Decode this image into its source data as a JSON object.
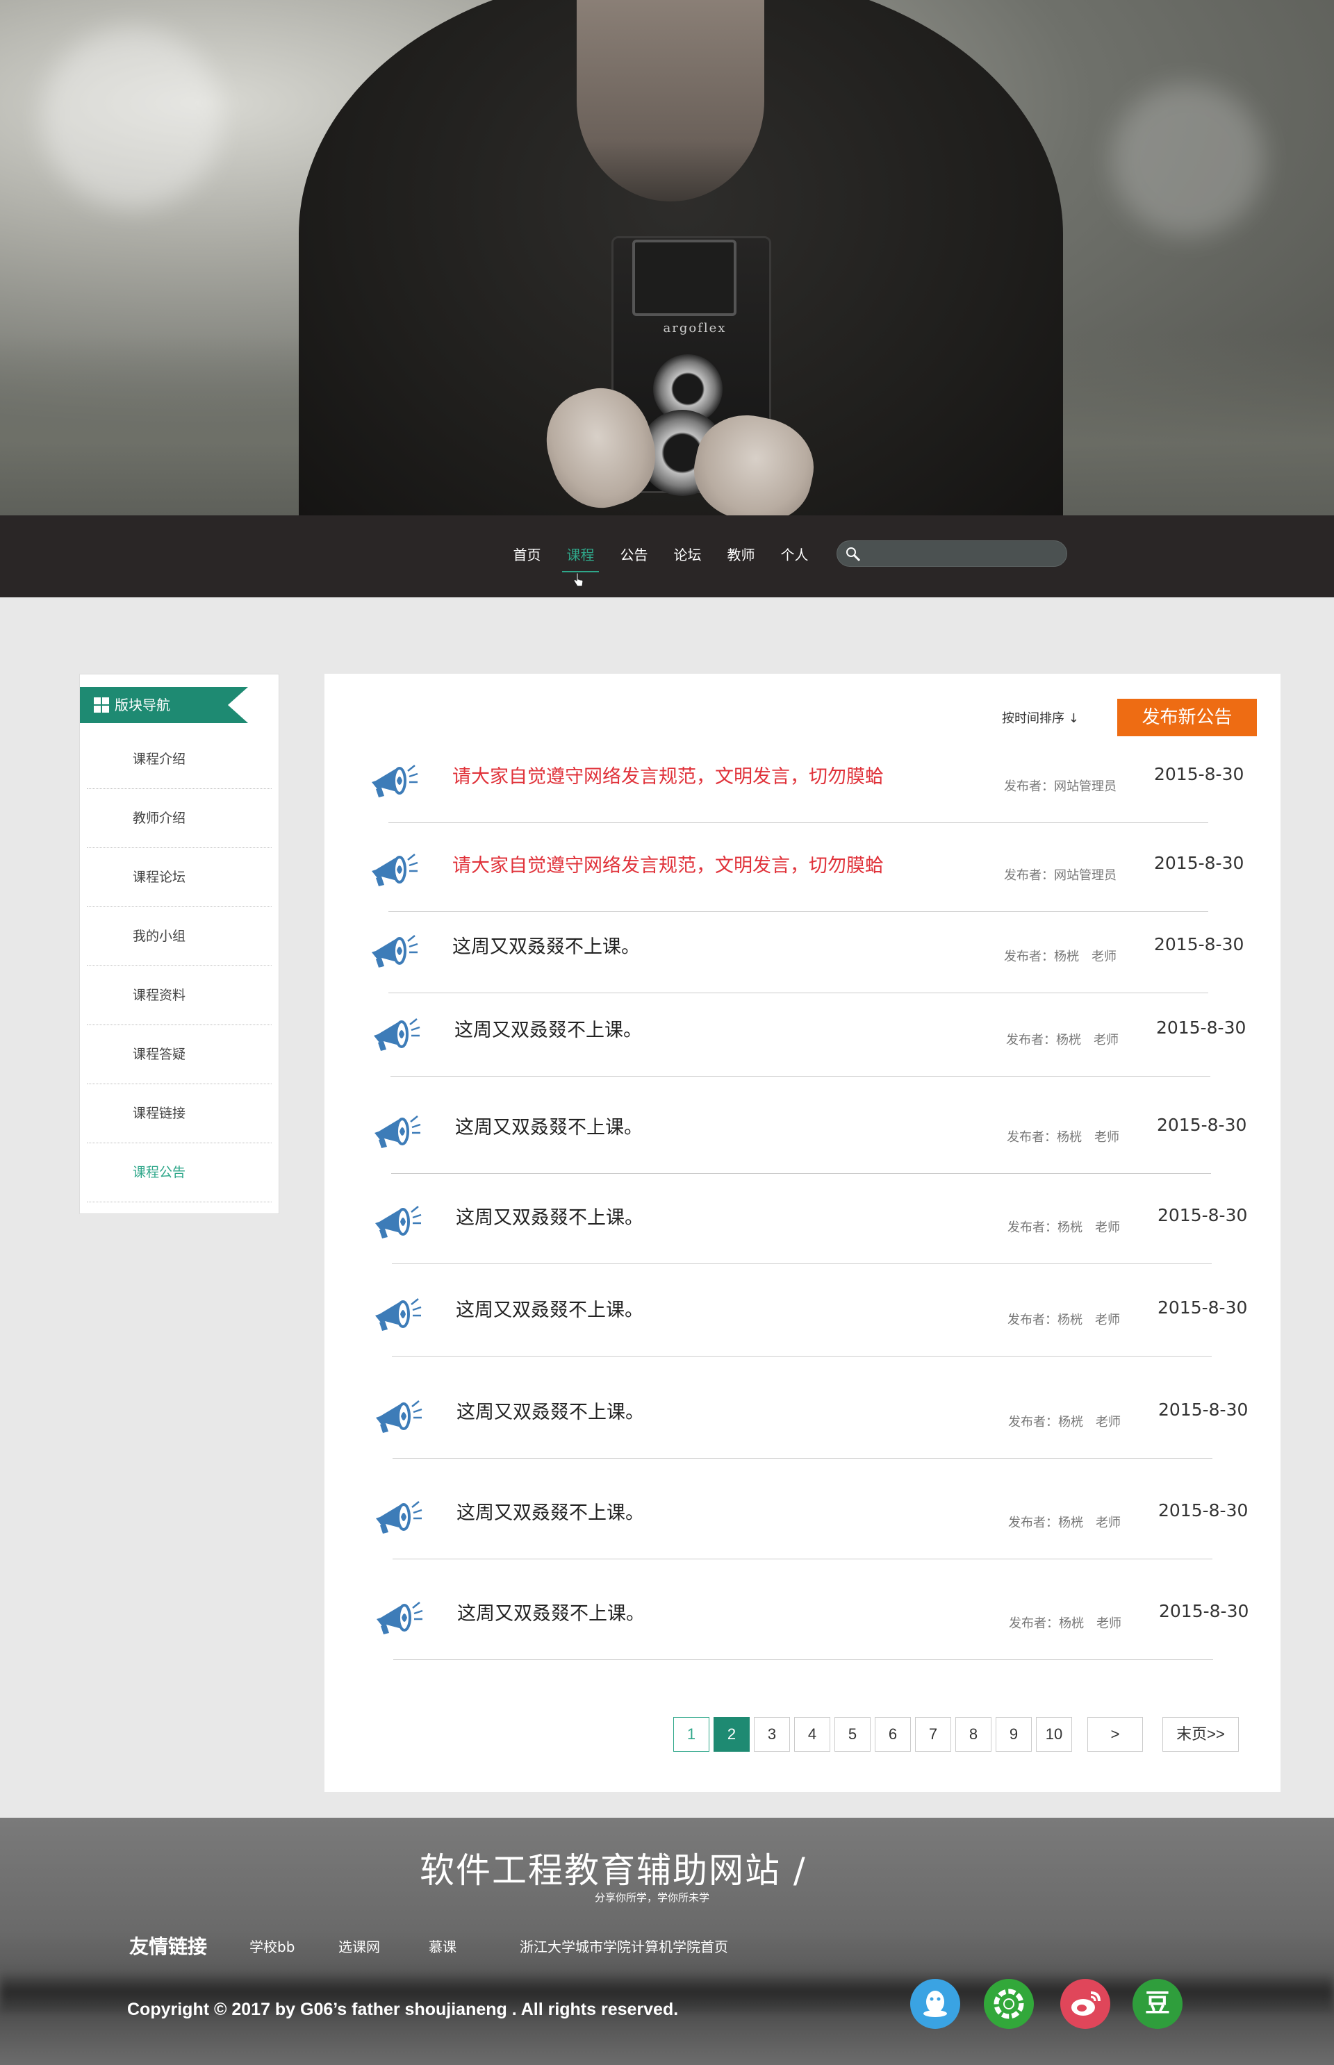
{
  "nav": {
    "items": [
      "首页",
      "课程",
      "公告",
      "论坛",
      "教师",
      "个人"
    ],
    "active_index": 1,
    "search_placeholder": ""
  },
  "hero": {
    "camera_label": "argoflex"
  },
  "sidebar": {
    "title": "版块导航",
    "items": [
      "课程介绍",
      "教师介绍",
      "课程论坛",
      "我的小组",
      "课程资料",
      "课程答疑",
      "课程链接",
      "课程公告"
    ],
    "active_index": 7
  },
  "toolbar": {
    "sort_label": "按时间排序 ↓",
    "publish_label": "发布新公告"
  },
  "notices": [
    {
      "title": "请大家自觉遵守网络发言规范，文明发言，切勿膜蛤",
      "author": "发布者：网站管理员",
      "date": "2015-8-30",
      "pinned": true
    },
    {
      "title": "请大家自觉遵守网络发言规范，文明发言，切勿膜蛤",
      "author": "发布者：网站管理员",
      "date": "2015-8-30",
      "pinned": true
    },
    {
      "title": "这周又双叒叕不上课。",
      "author": "发布者：杨桄　老师",
      "date": "2015-8-30",
      "pinned": false
    },
    {
      "title": "这周又双叒叕不上课。",
      "author": "发布者：杨桄　老师",
      "date": "2015-8-30",
      "pinned": false
    },
    {
      "title": "这周又双叒叕不上课。",
      "author": "发布者：杨桄　老师",
      "date": "2015-8-30",
      "pinned": false
    },
    {
      "title": "这周又双叒叕不上课。",
      "author": "发布者：杨桄　老师",
      "date": "2015-8-30",
      "pinned": false
    },
    {
      "title": "这周又双叒叕不上课。",
      "author": "发布者：杨桄　老师",
      "date": "2015-8-30",
      "pinned": false
    },
    {
      "title": "这周又双叒叕不上课。",
      "author": "发布者：杨桄　老师",
      "date": "2015-8-30",
      "pinned": false
    },
    {
      "title": "这周又双叒叕不上课。",
      "author": "发布者：杨桄　老师",
      "date": "2015-8-30",
      "pinned": false
    },
    {
      "title": "这周又双叒叕不上课。",
      "author": "发布者：杨桄　老师",
      "date": "2015-8-30",
      "pinned": false
    }
  ],
  "pagination": {
    "pages": [
      "1",
      "2",
      "3",
      "4",
      "5",
      "6",
      "7",
      "8",
      "9",
      "10"
    ],
    "current": "2",
    "next_label": ">",
    "last_label": "末页>>"
  },
  "footer": {
    "site_title": "软件工程教育辅助网站 /",
    "slogan": "分享你所学，学你所未学",
    "links_heading": "友情链接",
    "links": [
      "学校bb",
      "选课网",
      "慕课",
      "浙江大学城市学院计算机学院首页"
    ],
    "copyright": "Copyright © 2017 by G06’s father shoujianeng . All rights reserved.",
    "social": [
      {
        "name": "qq",
        "color": "#3aa3e3"
      },
      {
        "name": "wechat-moments",
        "color": "#32a83a"
      },
      {
        "name": "weibo",
        "color": "#e0465a"
      },
      {
        "name": "douban",
        "color": "#2f9e3c",
        "glyph": "豆"
      }
    ]
  },
  "colors": {
    "accent": "#1e8a72",
    "nav_active": "#2fa78a",
    "publish": "#ee6c13",
    "pinned_title": "#e0323a",
    "navbar_bg": "#2a2626"
  }
}
